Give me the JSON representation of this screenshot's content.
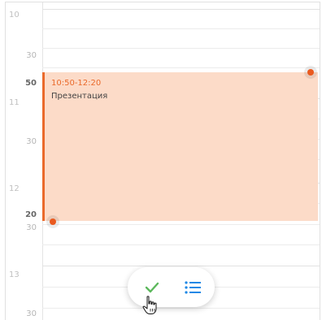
{
  "time_labels": {
    "h10": "10",
    "m10_30": "30",
    "m10_50": "50",
    "h11": "11",
    "m11_30": "30",
    "h12": "12",
    "m12_20": "20",
    "m12_30": "30",
    "h13": "13",
    "m13_30": "30"
  },
  "event": {
    "time_range": "10:50-12:20",
    "title": "Презентация",
    "color": "#ea6a2b",
    "background": "#fcdbc8"
  },
  "actions": {
    "confirm_icon": "checkmark-icon",
    "list_icon": "list-icon",
    "confirm_color": "#5cb85c",
    "list_color": "#1e88e5"
  },
  "cursor_icon": "hand-pointer-icon"
}
